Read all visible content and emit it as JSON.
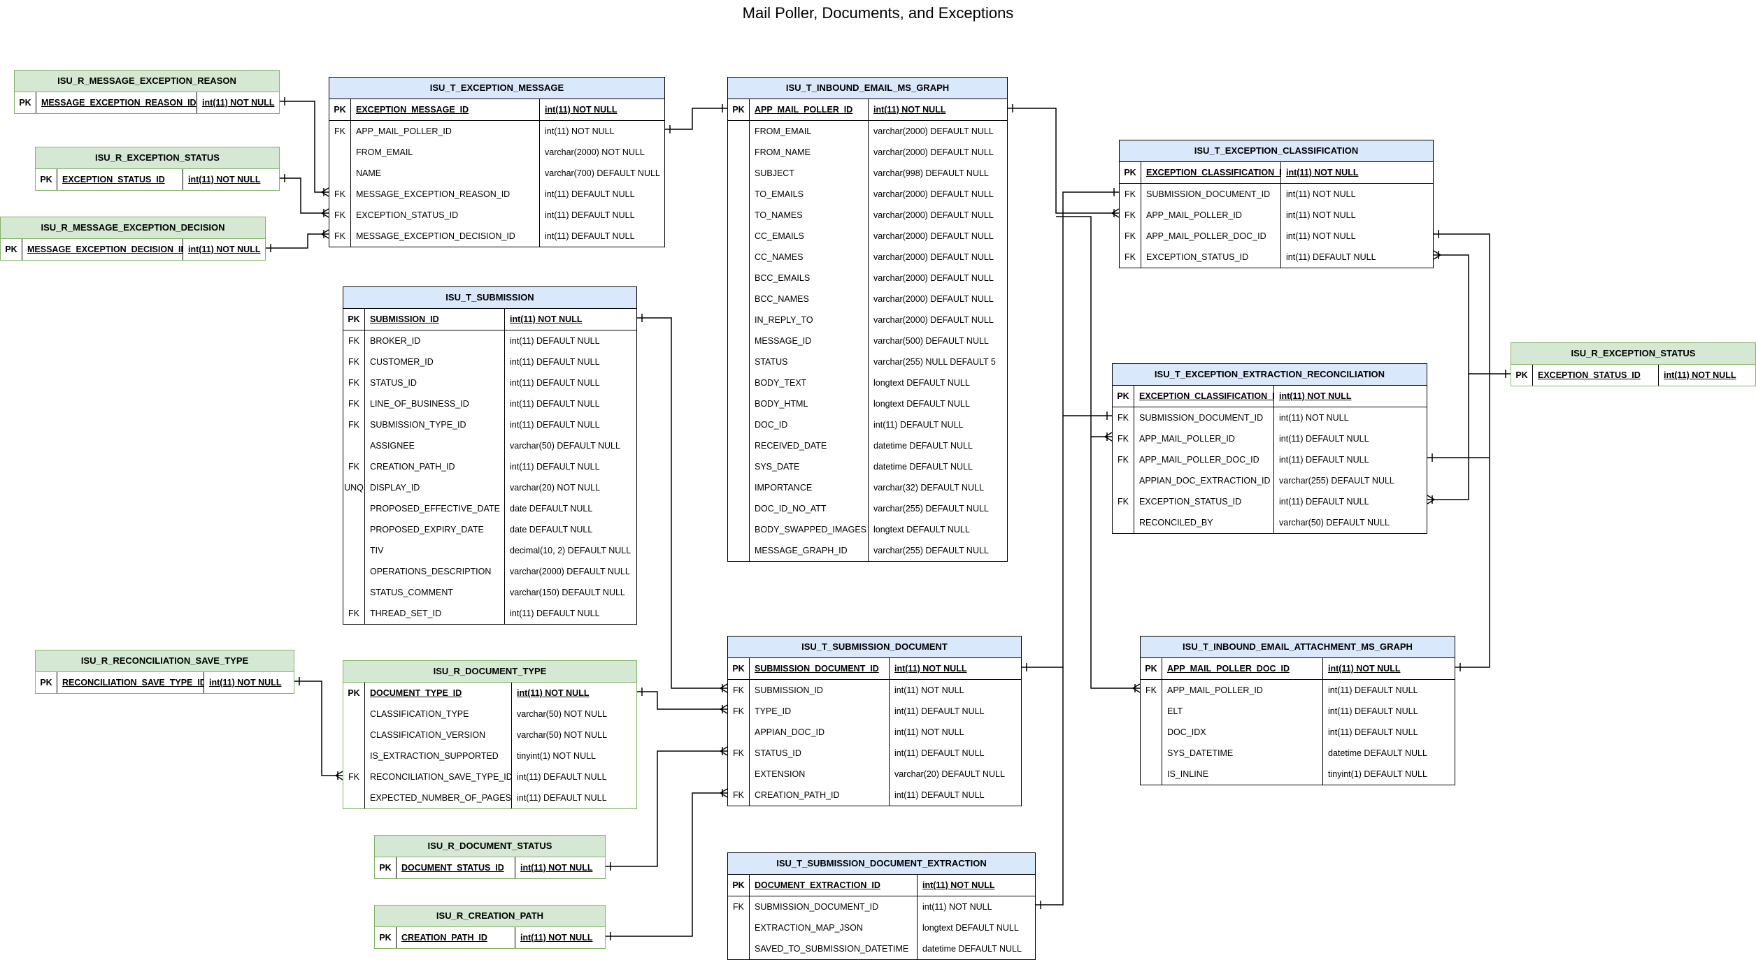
{
  "title": "Mail Poller, Documents, and Exceptions",
  "tables": {
    "msg_exc_reason": {
      "name": "ISU_R_MESSAGE_EXCEPTION_REASON",
      "kind": "reference",
      "pk": {
        "key": "PK",
        "column": "MESSAGE_EXCEPTION_REASON_ID",
        "type": "int(11) NOT NULL"
      },
      "rows": []
    },
    "exc_status_left": {
      "name": "ISU_R_EXCEPTION_STATUS",
      "kind": "reference",
      "pk": {
        "key": "PK",
        "column": "EXCEPTION_STATUS_ID",
        "type": "int(11) NOT NULL"
      },
      "rows": []
    },
    "msg_exc_decision": {
      "name": "ISU_R_MESSAGE_EXCEPTION_DECISION",
      "kind": "reference",
      "pk": {
        "key": "PK",
        "column": "MESSAGE_EXCEPTION_DECISION_ID",
        "type": "int(11) NOT NULL"
      },
      "rows": []
    },
    "exception_message": {
      "name": "ISU_T_EXCEPTION_MESSAGE",
      "kind": "transaction",
      "pk": {
        "key": "PK",
        "column": "EXCEPTION_MESSAGE_ID",
        "type": "int(11) NOT NULL"
      },
      "rows": [
        {
          "key": "FK",
          "column": "APP_MAIL_POLLER_ID",
          "type": "int(11) NOT NULL"
        },
        {
          "key": "",
          "column": "FROM_EMAIL",
          "type": "varchar(2000) NOT NULL"
        },
        {
          "key": "",
          "column": "NAME",
          "type": "varchar(700) DEFAULT NULL"
        },
        {
          "key": "FK",
          "column": "MESSAGE_EXCEPTION_REASON_ID",
          "type": "int(11) DEFAULT NULL"
        },
        {
          "key": "FK",
          "column": "EXCEPTION_STATUS_ID",
          "type": "int(11) DEFAULT NULL"
        },
        {
          "key": "FK",
          "column": "MESSAGE_EXCEPTION_DECISION_ID",
          "type": "int(11) DEFAULT NULL"
        }
      ]
    },
    "inbound_email": {
      "name": "ISU_T_INBOUND_EMAIL_MS_GRAPH",
      "kind": "transaction",
      "pk": {
        "key": "PK",
        "column": "APP_MAIL_POLLER_ID",
        "type": "int(11) NOT NULL"
      },
      "rows": [
        {
          "key": "",
          "column": "FROM_EMAIL",
          "type": "varchar(2000) DEFAULT NULL"
        },
        {
          "key": "",
          "column": "FROM_NAME",
          "type": "varchar(2000) DEFAULT NULL"
        },
        {
          "key": "",
          "column": "SUBJECT",
          "type": "varchar(998) DEFAULT NULL"
        },
        {
          "key": "",
          "column": "TO_EMAILS",
          "type": "varchar(2000) DEFAULT NULL"
        },
        {
          "key": "",
          "column": "TO_NAMES",
          "type": "varchar(2000) DEFAULT NULL"
        },
        {
          "key": "",
          "column": "CC_EMAILS",
          "type": "varchar(2000) DEFAULT NULL"
        },
        {
          "key": "",
          "column": "CC_NAMES",
          "type": "varchar(2000) DEFAULT NULL"
        },
        {
          "key": "",
          "column": "BCC_EMAILS",
          "type": "varchar(2000) DEFAULT NULL"
        },
        {
          "key": "",
          "column": "BCC_NAMES",
          "type": "varchar(2000) DEFAULT NULL"
        },
        {
          "key": "",
          "column": "IN_REPLY_TO",
          "type": "varchar(2000) DEFAULT NULL"
        },
        {
          "key": "",
          "column": "MESSAGE_ID",
          "type": "varchar(500) DEFAULT NULL"
        },
        {
          "key": "",
          "column": "STATUS",
          "type": "varchar(255) NULL DEFAULT 5"
        },
        {
          "key": "",
          "column": "BODY_TEXT",
          "type": "longtext DEFAULT NULL"
        },
        {
          "key": "",
          "column": "BODY_HTML",
          "type": "longtext DEFAULT NULL"
        },
        {
          "key": "",
          "column": "DOC_ID",
          "type": "int(11) DEFAULT NULL"
        },
        {
          "key": "",
          "column": "RECEIVED_DATE",
          "type": "datetime DEFAULT NULL"
        },
        {
          "key": "",
          "column": "SYS_DATE",
          "type": "datetime DEFAULT NULL"
        },
        {
          "key": "",
          "column": "IMPORTANCE",
          "type": "varchar(32) DEFAULT NULL"
        },
        {
          "key": "",
          "column": "DOC_ID_NO_ATT",
          "type": "varchar(255) DEFAULT NULL"
        },
        {
          "key": "",
          "column": "BODY_SWAPPED_IMAGES",
          "type": "longtext DEFAULT NULL"
        },
        {
          "key": "",
          "column": "MESSAGE_GRAPH_ID",
          "type": "varchar(255) DEFAULT NULL"
        }
      ]
    },
    "submission": {
      "name": "ISU_T_SUBMISSION",
      "kind": "transaction",
      "pk": {
        "key": "PK",
        "column": "SUBMISSION_ID",
        "type": "int(11) NOT NULL"
      },
      "rows": [
        {
          "key": "FK",
          "column": "BROKER_ID",
          "type": "int(11) DEFAULT NULL"
        },
        {
          "key": "FK",
          "column": "CUSTOMER_ID",
          "type": "int(11) DEFAULT NULL"
        },
        {
          "key": "FK",
          "column": "STATUS_ID",
          "type": "int(11) DEFAULT NULL"
        },
        {
          "key": "FK",
          "column": "LINE_OF_BUSINESS_ID",
          "type": "int(11) DEFAULT NULL"
        },
        {
          "key": "FK",
          "column": "SUBMISSION_TYPE_ID",
          "type": "int(11) DEFAULT NULL"
        },
        {
          "key": "",
          "column": "ASSIGNEE",
          "type": "varchar(50) DEFAULT NULL"
        },
        {
          "key": "FK",
          "column": "CREATION_PATH_ID",
          "type": "int(11) DEFAULT NULL"
        },
        {
          "key": "UNQ",
          "column": "DISPLAY_ID",
          "type": "varchar(20) NOT NULL"
        },
        {
          "key": "",
          "column": "PROPOSED_EFFECTIVE_DATE",
          "type": "date DEFAULT NULL"
        },
        {
          "key": "",
          "column": "PROPOSED_EXPIRY_DATE",
          "type": "date DEFAULT NULL"
        },
        {
          "key": "",
          "column": "TIV",
          "type": "decimal(10, 2) DEFAULT NULL"
        },
        {
          "key": "",
          "column": "OPERATIONS_DESCRIPTION",
          "type": "varchar(2000) DEFAULT NULL"
        },
        {
          "key": "",
          "column": "STATUS_COMMENT",
          "type": "varchar(150) DEFAULT NULL"
        },
        {
          "key": "FK",
          "column": "THREAD_SET_ID",
          "type": "int(11) DEFAULT NULL"
        }
      ]
    },
    "exc_classification": {
      "name": "ISU_T_EXCEPTION_CLASSIFICATION",
      "kind": "transaction",
      "pk": {
        "key": "PK",
        "column": "EXCEPTION_CLASSIFICATION_ID",
        "type": "int(11) NOT NULL"
      },
      "rows": [
        {
          "key": "FK",
          "column": "SUBMISSION_DOCUMENT_ID",
          "type": "int(11) NOT NULL"
        },
        {
          "key": "FK",
          "column": "APP_MAIL_POLLER_ID",
          "type": "int(11) NOT NULL"
        },
        {
          "key": "FK",
          "column": "APP_MAIL_POLLER_DOC_ID",
          "type": "int(11) NOT NULL"
        },
        {
          "key": "FK",
          "column": "EXCEPTION_STATUS_ID",
          "type": "int(11) DEFAULT NULL"
        }
      ]
    },
    "exc_extraction_recon": {
      "name": "ISU_T_EXCEPTION_EXTRACTION_RECONCILIATION",
      "kind": "transaction",
      "pk": {
        "key": "PK",
        "column": "EXCEPTION_CLASSIFICATION_ID",
        "type": "int(11) NOT NULL"
      },
      "rows": [
        {
          "key": "FK",
          "column": "SUBMISSION_DOCUMENT_ID",
          "type": "int(11) NOT NULL"
        },
        {
          "key": "FK",
          "column": "APP_MAIL_POLLER_ID",
          "type": "int(11) DEFAULT NULL"
        },
        {
          "key": "FK",
          "column": "APP_MAIL_POLLER_DOC_ID",
          "type": "int(11) DEFAULT NULL"
        },
        {
          "key": "",
          "column": "APPIAN_DOC_EXTRACTION_ID",
          "type": "varchar(255) DEFAULT NULL"
        },
        {
          "key": "FK",
          "column": "EXCEPTION_STATUS_ID",
          "type": "int(11) DEFAULT NULL"
        },
        {
          "key": "",
          "column": "RECONCILED_BY",
          "type": "varchar(50) DEFAULT NULL"
        }
      ]
    },
    "exc_status_right": {
      "name": "ISU_R_EXCEPTION_STATUS",
      "kind": "reference",
      "pk": {
        "key": "PK",
        "column": "EXCEPTION_STATUS_ID",
        "type": "int(11) NOT NULL"
      },
      "rows": []
    },
    "recon_save_type": {
      "name": "ISU_R_RECONCILIATION_SAVE_TYPE",
      "kind": "reference",
      "pk": {
        "key": "PK",
        "column": "RECONCILIATION_SAVE_TYPE_ID",
        "type": "int(11) NOT NULL"
      },
      "rows": []
    },
    "document_type": {
      "name": "ISU_R_DOCUMENT_TYPE",
      "kind": "reference",
      "pk": {
        "key": "PK",
        "column": "DOCUMENT_TYPE_ID",
        "type": "int(11) NOT NULL"
      },
      "rows": [
        {
          "key": "",
          "column": "CLASSIFICATION_TYPE",
          "type": "varchar(50) NOT NULL"
        },
        {
          "key": "",
          "column": "CLASSIFICATION_VERSION",
          "type": "varchar(50) NOT NULL"
        },
        {
          "key": "",
          "column": "IS_EXTRACTION_SUPPORTED",
          "type": "tinyint(1) NOT NULL"
        },
        {
          "key": "FK",
          "column": "RECONCILIATION_SAVE_TYPE_ID",
          "type": "int(11) DEFAULT NULL"
        },
        {
          "key": "",
          "column": "EXPECTED_NUMBER_OF_PAGES",
          "type": "int(11) DEFAULT NULL"
        }
      ]
    },
    "submission_document": {
      "name": "ISU_T_SUBMISSION_DOCUMENT",
      "kind": "transaction",
      "pk": {
        "key": "PK",
        "column": "SUBMISSION_DOCUMENT_ID",
        "type": "int(11) NOT NULL"
      },
      "rows": [
        {
          "key": "FK",
          "column": "SUBMISSION_ID",
          "type": "int(11) NOT NULL"
        },
        {
          "key": "FK",
          "column": "TYPE_ID",
          "type": "int(11) DEFAULT NULL"
        },
        {
          "key": "",
          "column": "APPIAN_DOC_ID",
          "type": "int(11) NOT NULL"
        },
        {
          "key": "FK",
          "column": "STATUS_ID",
          "type": "int(11) DEFAULT NULL"
        },
        {
          "key": "",
          "column": "EXTENSION",
          "type": "varchar(20) DEFAULT NULL"
        },
        {
          "key": "FK",
          "column": "CREATION_PATH_ID",
          "type": "int(11) DEFAULT NULL"
        }
      ]
    },
    "inbound_attachment": {
      "name": "ISU_T_INBOUND_EMAIL_ATTACHMENT_MS_GRAPH",
      "kind": "transaction",
      "pk": {
        "key": "PK",
        "column": "APP_MAIL_POLLER_DOC_ID",
        "type": "int(11) NOT NULL"
      },
      "rows": [
        {
          "key": "FK",
          "column": "APP_MAIL_POLLER_ID",
          "type": "int(11) DEFAULT NULL"
        },
        {
          "key": "",
          "column": "ELT",
          "type": "int(11) DEFAULT NULL"
        },
        {
          "key": "",
          "column": "DOC_IDX",
          "type": "int(11) DEFAULT NULL"
        },
        {
          "key": "",
          "column": "SYS_DATETIME",
          "type": "datetime DEFAULT NULL"
        },
        {
          "key": "",
          "column": "IS_INLINE",
          "type": "tinyint(1) DEFAULT NULL"
        }
      ]
    },
    "document_status": {
      "name": "ISU_R_DOCUMENT_STATUS",
      "kind": "reference",
      "pk": {
        "key": "PK",
        "column": "DOCUMENT_STATUS_ID",
        "type": "int(11) NOT NULL"
      },
      "rows": []
    },
    "creation_path": {
      "name": "ISU_R_CREATION_PATH",
      "kind": "reference",
      "pk": {
        "key": "PK",
        "column": "CREATION_PATH_ID",
        "type": "int(11) NOT NULL"
      },
      "rows": []
    },
    "sub_doc_extraction": {
      "name": "ISU_T_SUBMISSION_DOCUMENT_EXTRACTION",
      "kind": "transaction",
      "pk": {
        "key": "PK",
        "column": "DOCUMENT_EXTRACTION_ID",
        "type": "int(11) NOT NULL"
      },
      "rows": [
        {
          "key": "FK",
          "column": "SUBMISSION_DOCUMENT_ID",
          "type": "int(11) NOT NULL"
        },
        {
          "key": "",
          "column": "EXTRACTION_MAP_JSON",
          "type": "longtext DEFAULT NULL"
        },
        {
          "key": "",
          "column": "SAVED_TO_SUBMISSION_DATETIME",
          "type": "datetime DEFAULT NULL"
        }
      ]
    }
  },
  "relationships": [
    {
      "from": "msg_exc_reason.MESSAGE_EXCEPTION_REASON_ID",
      "to": "exception_message.MESSAGE_EXCEPTION_REASON_ID",
      "cardinality": "one-to-many"
    },
    {
      "from": "exc_status_left.EXCEPTION_STATUS_ID",
      "to": "exception_message.EXCEPTION_STATUS_ID",
      "cardinality": "one-to-many"
    },
    {
      "from": "msg_exc_decision.MESSAGE_EXCEPTION_DECISION_ID",
      "to": "exception_message.MESSAGE_EXCEPTION_DECISION_ID",
      "cardinality": "one-to-many"
    },
    {
      "from": "inbound_email.APP_MAIL_POLLER_ID",
      "to": "exception_message.APP_MAIL_POLLER_ID",
      "cardinality": "one-to-one"
    },
    {
      "from": "inbound_email.APP_MAIL_POLLER_ID",
      "to": "exc_classification.APP_MAIL_POLLER_ID",
      "cardinality": "one-to-many"
    },
    {
      "from": "inbound_email.APP_MAIL_POLLER_ID",
      "to": "exc_extraction_recon.APP_MAIL_POLLER_ID",
      "cardinality": "one-to-many"
    },
    {
      "from": "inbound_email.APP_MAIL_POLLER_ID",
      "to": "inbound_attachment.APP_MAIL_POLLER_ID",
      "cardinality": "one-to-many"
    },
    {
      "from": "submission_document.SUBMISSION_DOCUMENT_ID",
      "to": "exc_classification.SUBMISSION_DOCUMENT_ID",
      "cardinality": "one-to-one"
    },
    {
      "from": "submission_document.SUBMISSION_DOCUMENT_ID",
      "to": "exc_extraction_recon.SUBMISSION_DOCUMENT_ID",
      "cardinality": "one-to-one"
    },
    {
      "from": "inbound_attachment.APP_MAIL_POLLER_DOC_ID",
      "to": "exc_classification.APP_MAIL_POLLER_DOC_ID",
      "cardinality": "one-to-one"
    },
    {
      "from": "inbound_attachment.APP_MAIL_POLLER_DOC_ID",
      "to": "exc_extraction_recon.APP_MAIL_POLLER_DOC_ID",
      "cardinality": "one-to-one"
    },
    {
      "from": "exc_status_right.EXCEPTION_STATUS_ID",
      "to": "exc_classification.EXCEPTION_STATUS_ID",
      "cardinality": "one-to-many"
    },
    {
      "from": "exc_status_right.EXCEPTION_STATUS_ID",
      "to": "exc_extraction_recon.EXCEPTION_STATUS_ID",
      "cardinality": "one-to-many"
    },
    {
      "from": "submission.SUBMISSION_ID",
      "to": "submission_document.SUBMISSION_ID",
      "cardinality": "one-to-many"
    },
    {
      "from": "document_type.DOCUMENT_TYPE_ID",
      "to": "submission_document.TYPE_ID",
      "cardinality": "one-to-many"
    },
    {
      "from": "document_status.DOCUMENT_STATUS_ID",
      "to": "submission_document.STATUS_ID",
      "cardinality": "one-to-many"
    },
    {
      "from": "creation_path.CREATION_PATH_ID",
      "to": "submission_document.CREATION_PATH_ID",
      "cardinality": "one-to-many"
    },
    {
      "from": "recon_save_type.RECONCILIATION_SAVE_TYPE_ID",
      "to": "document_type.RECONCILIATION_SAVE_TYPE_ID",
      "cardinality": "one-to-many"
    },
    {
      "from": "submission_document.SUBMISSION_DOCUMENT_ID",
      "to": "sub_doc_extraction.SUBMISSION_DOCUMENT_ID",
      "cardinality": "one-to-one"
    }
  ],
  "colors": {
    "transaction_header": "#dae8fc",
    "reference_header": "#d5e8d4",
    "reference_border": "#82b366",
    "line": "#000000"
  }
}
